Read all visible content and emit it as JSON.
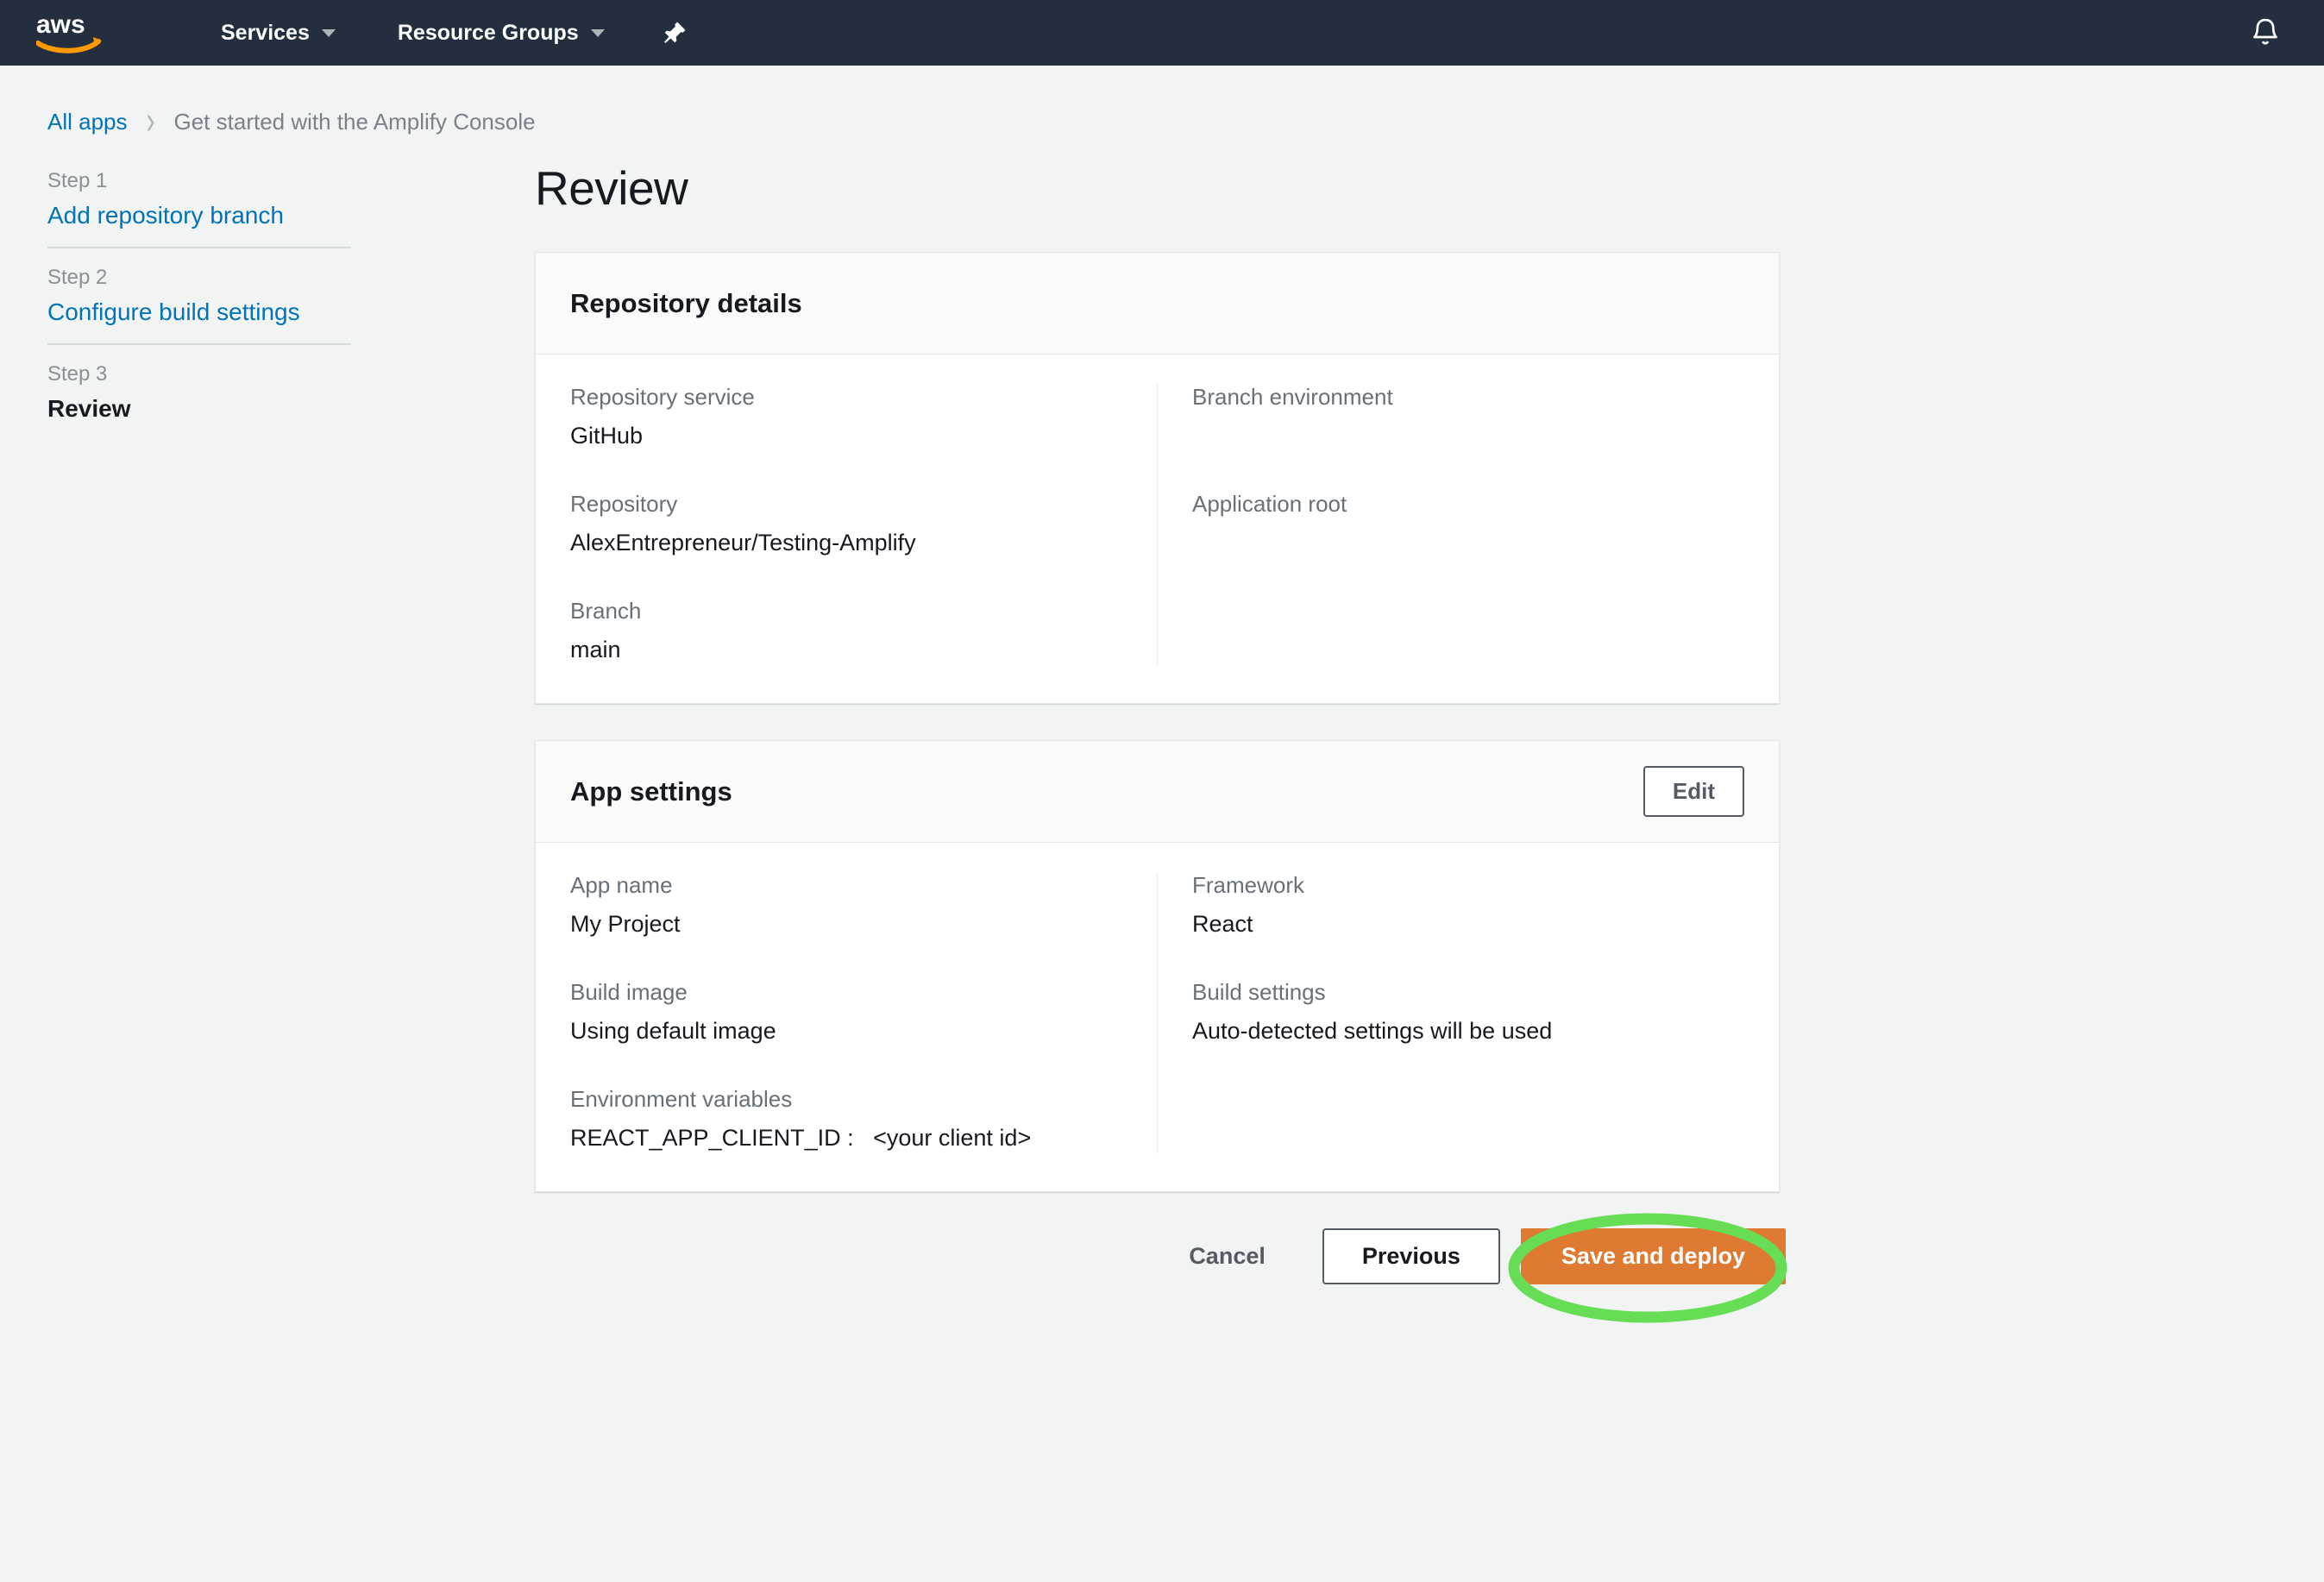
{
  "topnav": {
    "logo_alt": "aws",
    "services_label": "Services",
    "resource_groups_label": "Resource Groups",
    "pin_icon": "pin-icon",
    "bell_icon": "bell-icon"
  },
  "breadcrumb": {
    "root_label": "All apps",
    "separator": "›",
    "current_label": "Get started with the Amplify Console"
  },
  "steps": [
    {
      "step_label": "Step 1",
      "name": "Add repository branch",
      "state": "link"
    },
    {
      "step_label": "Step 2",
      "name": "Configure build settings",
      "state": "link"
    },
    {
      "step_label": "Step 3",
      "name": "Review",
      "state": "current"
    }
  ],
  "page": {
    "title": "Review"
  },
  "repository_card": {
    "title": "Repository details",
    "left_fields": [
      {
        "label": "Repository service",
        "value": "GitHub"
      },
      {
        "label": "Repository",
        "value": "AlexEntrepreneur/Testing-Amplify"
      },
      {
        "label": "Branch",
        "value": "main"
      }
    ],
    "right_fields": [
      {
        "label": "Branch environment",
        "value": ""
      },
      {
        "label": "Application root",
        "value": ""
      }
    ]
  },
  "app_settings_card": {
    "title": "App settings",
    "edit_label": "Edit",
    "left_fields": [
      {
        "label": "App name",
        "value": "My Project"
      },
      {
        "label": "Build image",
        "value": "Using default image"
      },
      {
        "label": "Environment variables",
        "value": "REACT_APP_CLIENT_ID :   <your client id>"
      }
    ],
    "right_fields": [
      {
        "label": "Framework",
        "value": "React"
      },
      {
        "label": "Build settings",
        "value": "Auto-detected settings will be used"
      }
    ]
  },
  "footer": {
    "cancel_label": "Cancel",
    "previous_label": "Previous",
    "deploy_label": "Save and deploy"
  },
  "annotation": {
    "shape": "ellipse-highlight",
    "target": "Save and deploy",
    "color": "#66DD55"
  },
  "colors": {
    "nav_background": "#232F3E",
    "page_background": "#F2F3F3",
    "link": "#0073BB",
    "primary_button": "#DF7A33",
    "annotation_green": "#66DD55",
    "aws_orange": "#FF9900"
  }
}
